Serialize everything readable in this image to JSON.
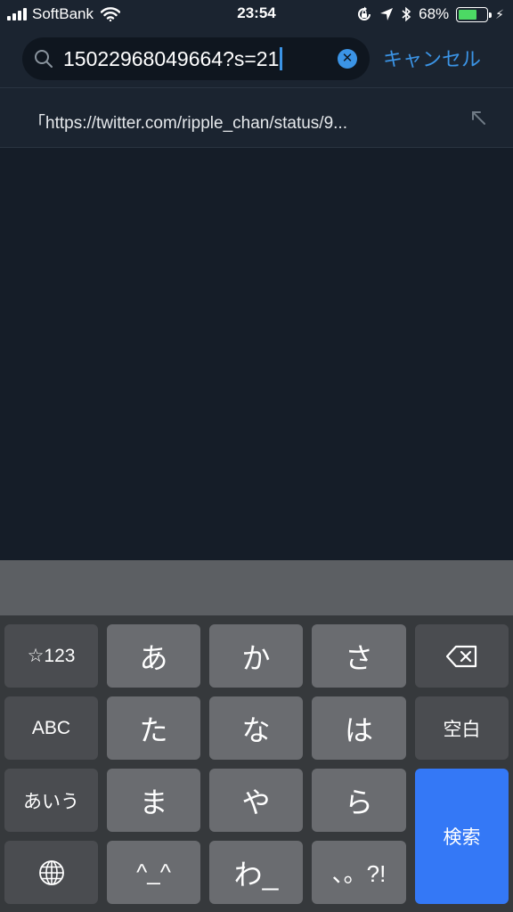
{
  "status_bar": {
    "carrier": "SoftBank",
    "time": "23:54",
    "battery_percent": "68%",
    "battery_level": 0.68,
    "colors": {
      "battery_fill": "#4cd964"
    },
    "icons": [
      "signal-icon",
      "wifi-icon",
      "orientation-lock-icon",
      "location-icon",
      "bluetooth-icon",
      "battery-icon",
      "charging-icon"
    ]
  },
  "search": {
    "query": "15022968049664?s=21",
    "cancel_label": "キャンセル",
    "accent_color": "#3b94e6"
  },
  "suggestion": {
    "text": "「https://twitter.com/ripple_chan/status/9..."
  },
  "keyboard": {
    "row1": {
      "mode": "☆123",
      "k1": "あ",
      "k2": "か",
      "k3": "さ",
      "delete_icon": "backspace-icon"
    },
    "row2": {
      "mode": "ABC",
      "k1": "た",
      "k2": "な",
      "k3": "は",
      "space": "空白"
    },
    "row3": {
      "mode": "あいう",
      "k1": "ま",
      "k2": "や",
      "k3": "ら"
    },
    "row4": {
      "globe_icon": "globe-icon",
      "k1": "^_^",
      "k2": "わ_",
      "k3": "、。?!"
    },
    "search_key": "検索",
    "colors": {
      "search_key": "#3478f6"
    }
  }
}
